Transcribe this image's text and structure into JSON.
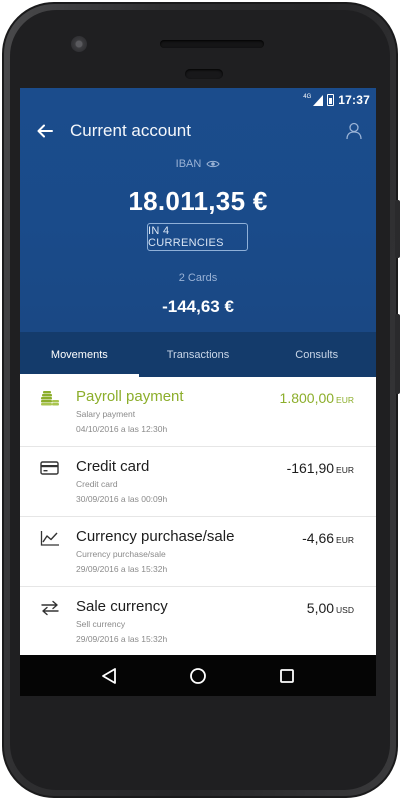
{
  "status": {
    "network": "4G",
    "time": "17:37"
  },
  "header": {
    "title": "Current account"
  },
  "account": {
    "iban_label": "IBAN",
    "balance": "18.011,35 €",
    "currencies_button": "IN 4 CURRENCIES",
    "cards_label": "2 Cards",
    "cards_amount": "-144,63 €"
  },
  "tabs": [
    {
      "label": "Movements",
      "active": true
    },
    {
      "label": "Transactions",
      "active": false
    },
    {
      "label": "Consults",
      "active": false
    }
  ],
  "movements": [
    {
      "icon": "coins-icon",
      "title": "Payroll payment",
      "subtitle": "Salary payment",
      "date": "04/10/2016 a las 12:30h",
      "amount": "1.800,00",
      "currency": "EUR"
    },
    {
      "icon": "credit-card-icon",
      "title": "Credit card",
      "subtitle": "Credit card",
      "date": "30/09/2016 a las 00:09h",
      "amount": "-161,90",
      "currency": "EUR"
    },
    {
      "icon": "trend-chart-icon",
      "title": "Currency purchase/sale",
      "subtitle": "Currency purchase/sale",
      "date": "29/09/2016 a las 15:32h",
      "amount": "-4,66",
      "currency": "EUR"
    },
    {
      "icon": "exchange-arrows-icon",
      "title": "Sale currency",
      "subtitle": "Sell currency",
      "date": "29/09/2016 a las 15:32h",
      "amount": "5,00",
      "currency": "USD"
    }
  ],
  "colors": {
    "primary": "#1b4c8c",
    "tab_bar": "#143b6b",
    "positive": "#8cae2b"
  }
}
